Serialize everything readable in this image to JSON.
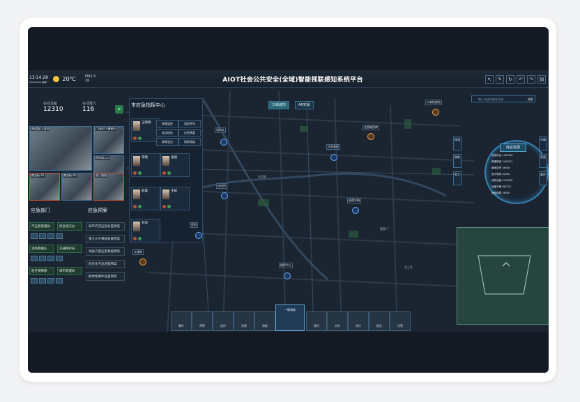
{
  "header": {
    "time": "13:14:28",
    "date": "2023-05-01 星期一",
    "temperature": "20℃",
    "pm": "PM2.5",
    "pm_value": "26",
    "title": "AIOT社会公共安全(全域)智能视联感知系统平台",
    "tool_icons": [
      "pointer-icon",
      "draw-icon",
      "rotate-icon",
      "undo-icon",
      "redo-icon",
      "layers-icon"
    ]
  },
  "stats": {
    "left_label": "在线设备",
    "left_value": "12310",
    "right_label": "在线警力",
    "right_value": "116"
  },
  "cameras": [
    {
      "caption": "海淀路口-监控",
      "alert": false
    },
    {
      "caption": "广场东门-摄像头",
      "alert": false
    },
    {
      "caption": "停车场入口",
      "alert": false
    },
    {
      "caption": "北门通道",
      "alert": true
    },
    {
      "caption": "商业街-01",
      "alert": true
    },
    {
      "caption": "商业街-02",
      "alert": false
    },
    {
      "caption": "地下车库",
      "alert": false
    }
  ],
  "departments": {
    "title": "应急部门",
    "items": [
      "市应急管理局",
      "综合减灾办",
      "消防救援队",
      "交通保护局",
      "医疗保障部",
      "城市管理局"
    ]
  },
  "plans": {
    "title": "应急预案",
    "items": [
      "城市内涝应急处置预案",
      "重大火灾事故处置预案",
      "地质灾害应急救援预案",
      "危险化学品泄漏预案",
      "群体性事件处置预案"
    ]
  },
  "command": {
    "title": "市应急指挥中心",
    "people": [
      {
        "name": "王晓明",
        "role": "指挥长"
      },
      {
        "name": "李刚",
        "role": "副指挥"
      },
      {
        "name": "张楠",
        "role": "调度员"
      },
      {
        "name": "赵磊",
        "role": "调度员"
      },
      {
        "name": "王斌",
        "role": "联络员"
      },
      {
        "name": "刘洋",
        "role": "联络员"
      }
    ],
    "menu": [
      "视频监控",
      "语音呼叫",
      "发送短信",
      "应急预案",
      "视频会议",
      "指挥调度"
    ]
  },
  "map": {
    "layer_tabs": [
      "三维城市",
      "AR实景"
    ],
    "markers": [
      {
        "label": "公安检查站",
        "color": "orange"
      },
      {
        "label": "消防站",
        "color": "blue"
      },
      {
        "label": "应急救援",
        "color": "blue"
      },
      {
        "label": "派出所",
        "color": "blue"
      },
      {
        "label": "医院",
        "color": "blue"
      },
      {
        "label": "应急物资库",
        "color": "orange"
      },
      {
        "label": "巡逻车辆",
        "color": "blue"
      },
      {
        "label": "指挥中心",
        "color": "blue"
      },
      {
        "label": "交通岗",
        "color": "blue"
      }
    ],
    "roads": [
      "光华路",
      "东三环",
      "建国门"
    ]
  },
  "resources": {
    "search_placeholder": "输入关键词搜索资源",
    "search_button": "搜索",
    "title": "综合资源",
    "rows": [
      {
        "name": "应急队伍",
        "count": "128/356"
      },
      {
        "name": "救援物资",
        "count": "245/512"
      },
      {
        "name": "避难场所",
        "count": "36/48"
      },
      {
        "name": "医疗机构",
        "count": "42/60"
      },
      {
        "name": "消防设施",
        "count": "210/300"
      },
      {
        "name": "运输车辆",
        "count": "88/120"
      },
      {
        "name": "通信保障",
        "count": "56/80"
      }
    ],
    "side_tags": [
      "视频",
      "物联",
      "警力",
      "车辆",
      "预案",
      "事件"
    ]
  },
  "dock": {
    "items": [
      "事件",
      "预警",
      "监控",
      "资源",
      "调度",
      "通讯",
      "分析",
      "统计",
      "报告",
      "设置"
    ],
    "center_label": "一键调度"
  },
  "colors": {
    "background": "#1a2330",
    "accent": "#3a7fb0",
    "alert": "#c1543a",
    "green": "#2a7b4b"
  }
}
